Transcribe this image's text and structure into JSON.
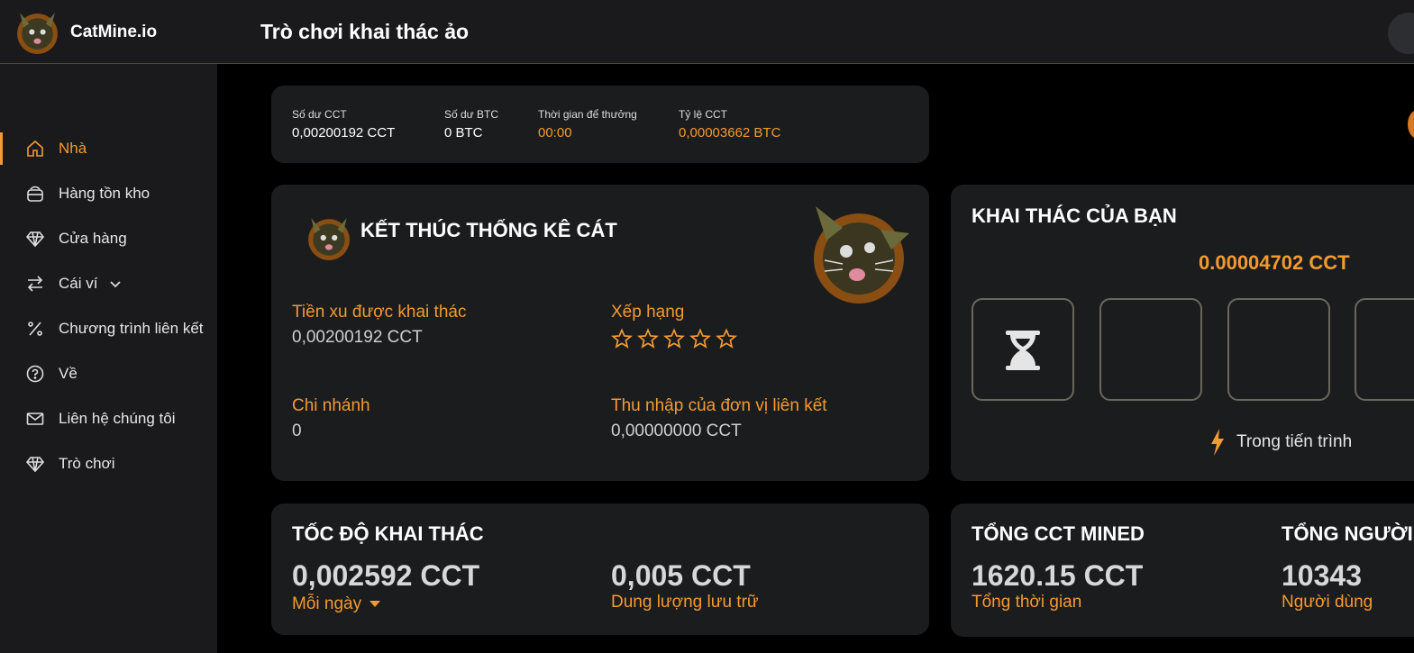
{
  "app": {
    "name": "CatMine.io",
    "page_title": "Trò chơi khai thác ảo"
  },
  "sidebar": {
    "items": [
      {
        "label": "Nhà",
        "icon": "home-icon",
        "active": true
      },
      {
        "label": "Hàng tồn kho",
        "icon": "inventory-icon"
      },
      {
        "label": "Cửa hàng",
        "icon": "diamond-icon"
      },
      {
        "label": "Cái ví",
        "icon": "transfer-icon",
        "has_dropdown": true
      },
      {
        "label": "Chương trình liên kết",
        "icon": "percent-icon"
      },
      {
        "label": "Về",
        "icon": "help-circle-icon"
      },
      {
        "label": "Liên hệ chúng tôi",
        "icon": "mail-icon"
      },
      {
        "label": "Trò chơi",
        "icon": "diamond-icon"
      }
    ]
  },
  "stats_bar": {
    "cct_balance": {
      "label": "Số dư CCT",
      "value": "0,00200192 CCT"
    },
    "btc_balance": {
      "label": "Số dư BTC",
      "value": "0 BTC"
    },
    "reward_time": {
      "label": "Thời gian để thưởng",
      "value": "00:00"
    },
    "cct_rate": {
      "label": "Tỷ lệ CCT",
      "value": "0,00003662 BTC"
    }
  },
  "cat_stats": {
    "title": "KẾT THÚC THỐNG KÊ CÁT",
    "mined_coins": {
      "label": "Tiền xu được khai thác",
      "value": "0,00200192 CCT"
    },
    "rank": {
      "label": "Xếp hạng",
      "stars_filled": 0,
      "stars_total": 5
    },
    "branch": {
      "label": "Chi nhánh",
      "value": "0"
    },
    "affiliate_income": {
      "label": "Thu nhập của đơn vị liên kết",
      "value": "0,00000000 CCT"
    }
  },
  "your_mining": {
    "title": "KHAI THÁC CỦA BẠN",
    "amount": "0.00004702 CCT",
    "status": "Trong tiến trình"
  },
  "mining_speed": {
    "title": "TỐC ĐỘ KHAI THÁC",
    "speed": "0,002592 CCT",
    "period": "Mỗi ngày",
    "storage": "0,005 CCT",
    "storage_label": "Dung lượng lưu trữ"
  },
  "totals": {
    "mined_title": "TỔNG CCT MINED",
    "mined_value": "1620.15 CCT",
    "mined_sub": "Tổng thời gian",
    "users_title": "TỔNG NGƯỜI",
    "users_value": "10343",
    "users_sub": "Người dùng"
  },
  "colors": {
    "accent": "#f39a30",
    "card": "#1b1c1e",
    "sidebar": "#1a1a1c",
    "background": "#000000"
  }
}
